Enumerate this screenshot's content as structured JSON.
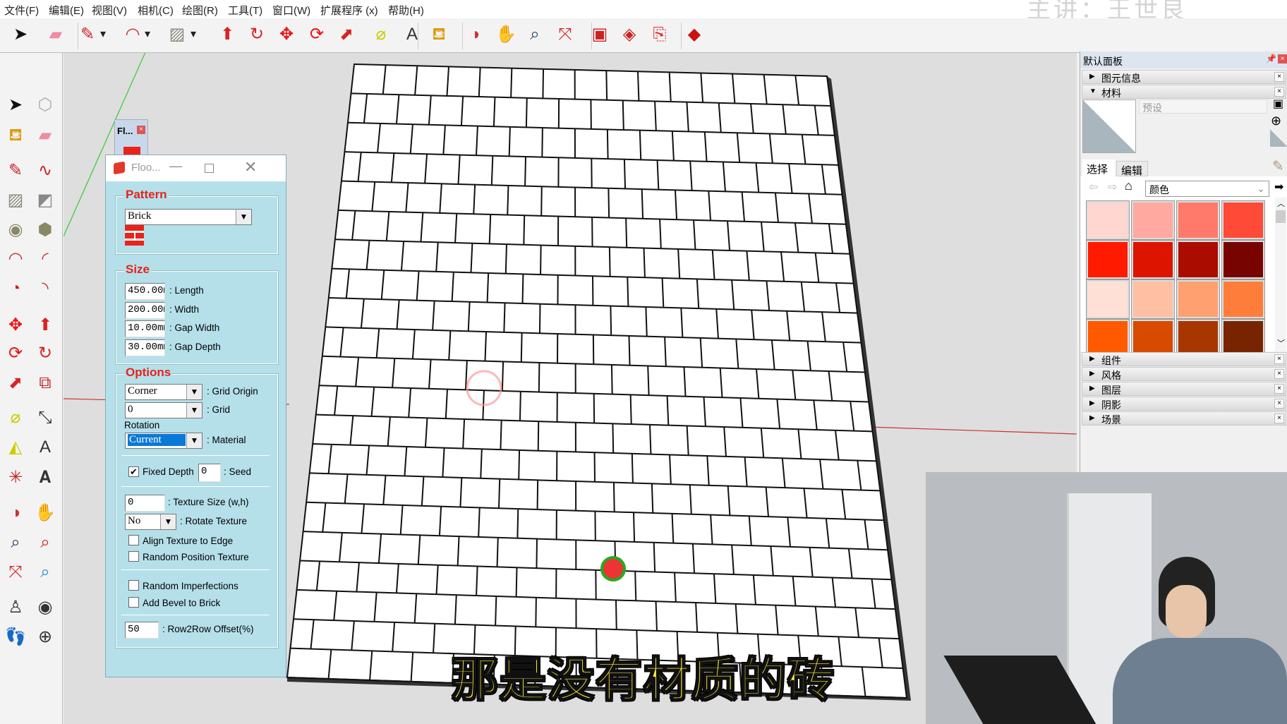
{
  "menu": [
    "文件(F)",
    "编辑(E)",
    "视图(V)",
    "相机(C)",
    "绘图(R)",
    "工具(T)",
    "窗口(W)",
    "扩展程序 (x)",
    "帮助(H)"
  ],
  "watermark": "主讲：王世良",
  "toolbar_icons": [
    "select-icon",
    "eraser-icon",
    "pencil-icon",
    "dropdown-arrow-icon",
    "arc-icon",
    "dropdown-arrow-icon",
    "rectangle-icon",
    "dropdown-arrow-icon",
    "push-pull-icon",
    "follow-me-icon",
    "move-icon",
    "rotate-icon",
    "scale-icon",
    "tape-measure-icon",
    "text-icon",
    "paint-bucket-icon",
    "orbit-icon",
    "pan-icon",
    "zoom-icon",
    "zoom-extents-icon",
    "warehouse-icon",
    "extension-warehouse-icon",
    "send-to-layout-icon",
    "ruby-icon"
  ],
  "left_toolbar_icons": [
    "select-icon",
    "make-component-icon",
    "paint-bucket-icon",
    "eraser-icon",
    "pencil-icon",
    "freehand-icon",
    "rectangle-icon",
    "rotated-rectangle-icon",
    "circle-icon",
    "polygon-icon",
    "arc-icon",
    "two-point-arc-icon",
    "pie-icon",
    "three-point-arc-icon",
    "move-icon",
    "push-pull-icon",
    "rotate-icon",
    "follow-me-icon",
    "scale-icon",
    "offset-icon",
    "tape-measure-icon",
    "dimension-icon",
    "protractor-icon",
    "text-icon",
    "axes-icon",
    "3d-text-icon",
    "orbit-icon",
    "pan-icon",
    "zoom-icon",
    "zoom-window-icon",
    "zoom-extents-icon",
    "previous-view-icon",
    "position-camera-icon",
    "look-around-icon",
    "walk-icon",
    "section-plane-icon"
  ],
  "mini_window": {
    "title": "Fl..."
  },
  "dialog": {
    "title": "Floo...",
    "pattern": {
      "legend": "Pattern",
      "value": "Brick"
    },
    "size": {
      "legend": "Size",
      "fields": [
        {
          "value": "450.00m",
          "label": ": Length"
        },
        {
          "value": "200.00m",
          "label": ": Width"
        },
        {
          "value": "10.00mm",
          "label": ": Gap Width"
        },
        {
          "value": "30.00mm",
          "label": ": Gap Depth"
        }
      ]
    },
    "options": {
      "legend": "Options",
      "grid_origin": {
        "value": "Corner",
        "label": ": Grid Origin"
      },
      "grid": {
        "value": "0",
        "label": ": Grid"
      },
      "rotation_label": "Rotation",
      "material": {
        "value": "Current",
        "label": ": Material"
      },
      "fixed_depth": {
        "label": "Fixed Depth",
        "checked": true
      },
      "seed": {
        "value": "0",
        "label": ": Seed"
      },
      "texture_size": {
        "value": "0",
        "label": ": Texture Size (w,h)"
      },
      "rotate_texture": {
        "value": "No",
        "label": ": Rotate Texture"
      },
      "align_texture": {
        "label": "Align Texture to Edge",
        "checked": false
      },
      "random_position": {
        "label": "Random Position Texture",
        "checked": false
      },
      "random_imperfections": {
        "label": "Random Imperfections",
        "checked": false
      },
      "add_bevel": {
        "label": "Add Bevel to Brick",
        "checked": false
      },
      "row_offset": {
        "value": "50",
        "label": ": Row2Row Offset(%)"
      }
    }
  },
  "panel": {
    "title": "默认面板",
    "sections_top": [
      {
        "label": "图元信息",
        "expanded": false
      },
      {
        "label": "材料",
        "expanded": true
      }
    ],
    "material_name_placeholder": "预设",
    "tabs": [
      "选择",
      "编辑"
    ],
    "library": "颜色",
    "swatches": [
      "#ffd6d0",
      "#ffa9a0",
      "#ff7a6a",
      "#ff4a38",
      "#ff1a00",
      "#dc1400",
      "#aa0d00",
      "#780400",
      "#ffe0d6",
      "#ffbfa3",
      "#ffa070",
      "#ff7d3a",
      "#ff5a00",
      "#d84a00",
      "#a83600",
      "#782400"
    ],
    "sections_bottom": [
      {
        "label": "组件"
      },
      {
        "label": "风格"
      },
      {
        "label": "图层"
      },
      {
        "label": "阴影"
      },
      {
        "label": "场景"
      }
    ]
  },
  "subtitle": "那是没有材质的砖",
  "colors": {
    "accent_red": "#e8231a",
    "dialog_bg": "#b5e0ea",
    "selection_blue": "#0a78d7",
    "subtitle_yellow": "#ffef3a"
  }
}
